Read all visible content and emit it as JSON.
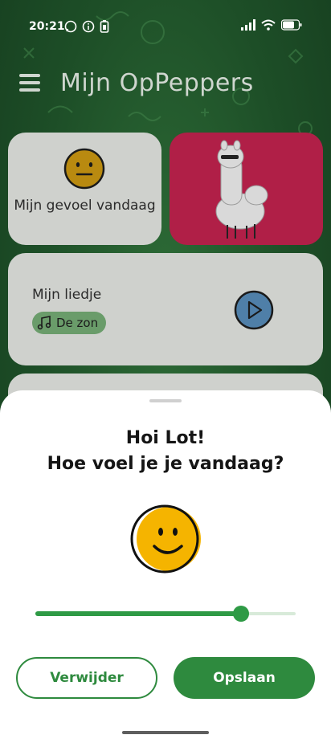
{
  "status_bar": {
    "time": "20:21"
  },
  "header": {
    "title": "Mijn OpPeppers"
  },
  "cards": {
    "mood": {
      "label": "Mijn gevoel vandaag"
    },
    "song": {
      "title": "Mijn liedje",
      "chip_label": "De zon"
    }
  },
  "sheet": {
    "greeting": "Hoi Lot!",
    "question": "Hoe voel je je vandaag?",
    "mood_level": 0.79,
    "delete_label": "Verwijder",
    "save_label": "Opslaan"
  },
  "colors": {
    "accent": "#2e8a3e",
    "alpaca_card": "#b01f47",
    "face_yellow": "#f5b400"
  },
  "icons": [
    "whatsapp-icon",
    "info-icon",
    "battery-saver-icon",
    "signal-icon",
    "wifi-icon",
    "battery-icon",
    "menu-icon",
    "neutral-face-icon",
    "music-note-icon",
    "play-icon",
    "happy-face-icon"
  ]
}
